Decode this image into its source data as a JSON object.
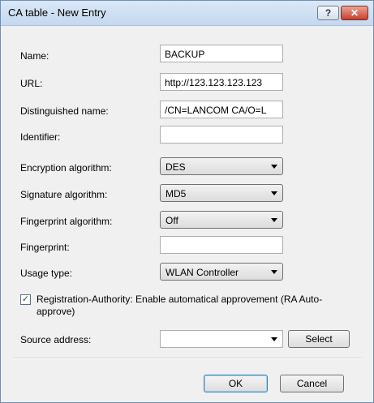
{
  "window": {
    "title": "CA table - New Entry",
    "help_glyph": "?",
    "close_glyph": "✕"
  },
  "form": {
    "name_label": "Name:",
    "name_value": "BACKUP",
    "url_label": "URL:",
    "url_value": "http://123.123.123.123",
    "dn_label": "Distinguished name:",
    "dn_value": "/CN=LANCOM CA/O=L",
    "identifier_label": "Identifier:",
    "identifier_value": "",
    "enc_label": "Encryption algorithm:",
    "enc_value": "DES",
    "sig_label": "Signature algorithm:",
    "sig_value": "MD5",
    "fp_alg_label": "Fingerprint algorithm:",
    "fp_alg_value": "Off",
    "fingerprint_label": "Fingerprint:",
    "fingerprint_value": "",
    "usage_label": "Usage type:",
    "usage_value": "WLAN Controller",
    "ra_checked": true,
    "ra_check_glyph": "✓",
    "ra_label": "Registration-Authority: Enable automatical approvement (RA Auto-approve)",
    "source_label": "Source address:",
    "source_value": "",
    "select_button": "Select"
  },
  "buttons": {
    "ok": "OK",
    "cancel": "Cancel"
  }
}
